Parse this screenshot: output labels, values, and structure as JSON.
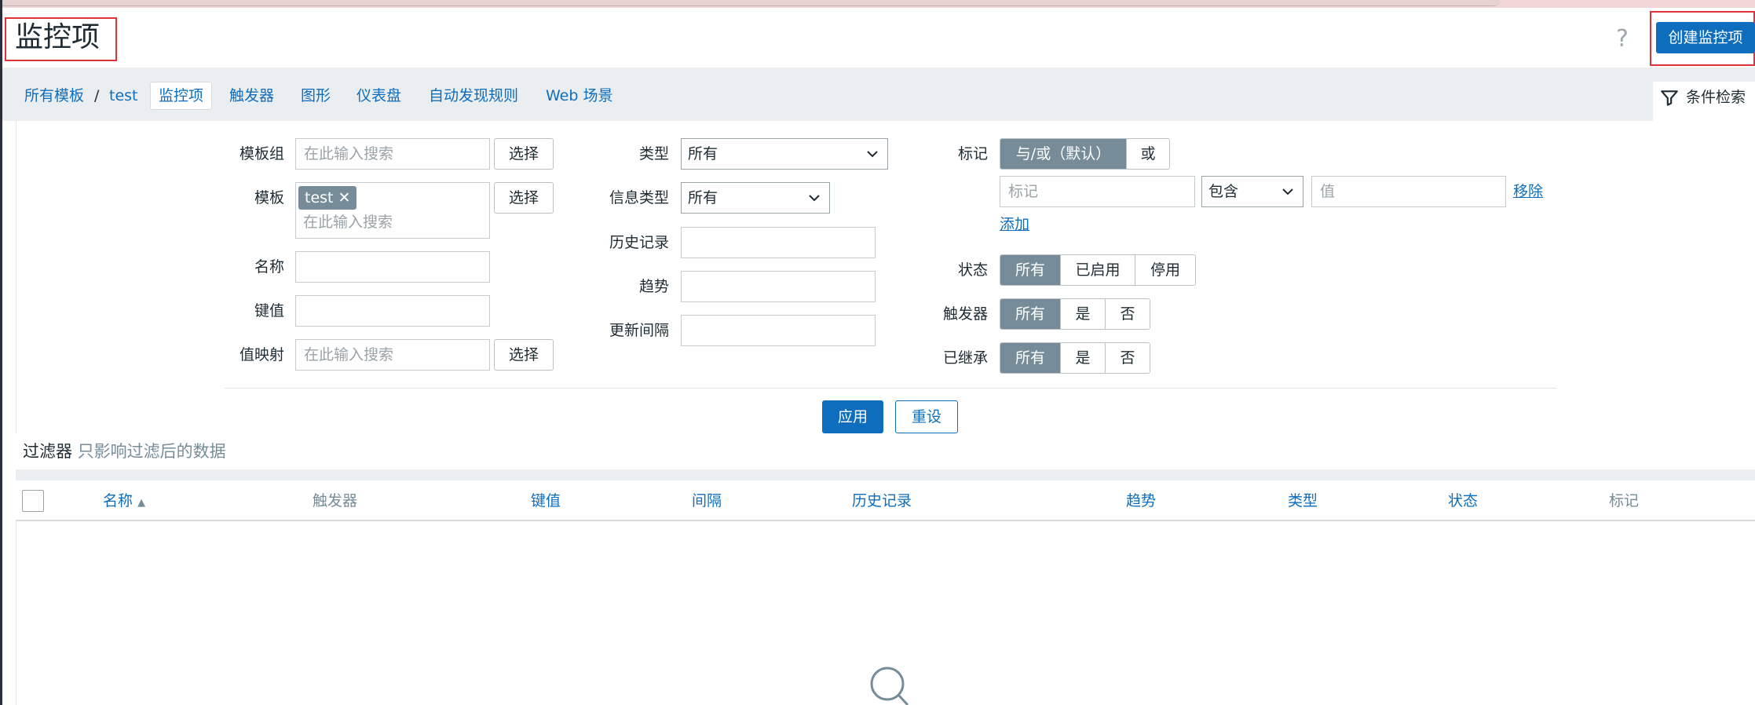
{
  "page": {
    "title": "监控项",
    "help": "?",
    "create_button": "创建监控项"
  },
  "breadcrumb": {
    "root": "所有模板",
    "separator": "/",
    "template": "test"
  },
  "tabs": [
    "监控项",
    "触发器",
    "图形",
    "仪表盘",
    "自动发现规则",
    "Web 场景"
  ],
  "filter_tab": "条件检索",
  "filter": {
    "template_group": {
      "label": "模板组",
      "placeholder": "在此输入搜索",
      "select": "选择"
    },
    "template": {
      "label": "模板",
      "tag": "test",
      "tag_remove": "✕",
      "placeholder": "在此输入搜索",
      "select": "选择"
    },
    "name": {
      "label": "名称",
      "value": ""
    },
    "key": {
      "label": "键值",
      "value": ""
    },
    "value_map": {
      "label": "值映射",
      "placeholder": "在此输入搜索",
      "select": "选择"
    },
    "type": {
      "label": "类型",
      "value": "所有"
    },
    "info_type": {
      "label": "信息类型",
      "value": "所有"
    },
    "history": {
      "label": "历史记录",
      "value": ""
    },
    "trends": {
      "label": "趋势",
      "value": ""
    },
    "update_interval": {
      "label": "更新间隔",
      "value": ""
    },
    "tags": {
      "label": "标记",
      "mode_options": [
        "与/或（默认）",
        "或"
      ],
      "tag_placeholder": "标记",
      "operator": "包含",
      "value_placeholder": "值",
      "remove": "移除",
      "add": "添加"
    },
    "state": {
      "label": "状态",
      "options": [
        "所有",
        "已启用",
        "停用"
      ]
    },
    "triggers": {
      "label": "触发器",
      "options": [
        "所有",
        "是",
        "否"
      ]
    },
    "inherited": {
      "label": "已继承",
      "options": [
        "所有",
        "是",
        "否"
      ]
    },
    "apply": "应用",
    "reset": "重设",
    "note_label": "过滤器",
    "note_text": "只影响过滤后的数据"
  },
  "table": {
    "columns": [
      "名称",
      "触发器",
      "键值",
      "间隔",
      "历史记录",
      "趋势",
      "类型",
      "状态",
      "标记"
    ],
    "sort_indicator": "▲"
  }
}
